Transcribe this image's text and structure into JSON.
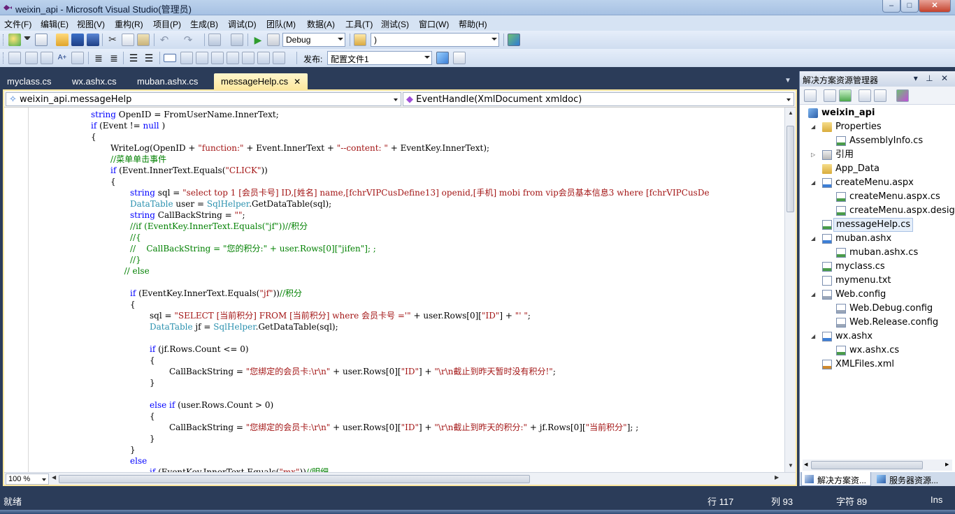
{
  "window": {
    "title": "weixin_api - Microsoft Visual Studio(管理员)",
    "minimize": "–",
    "maximize": "□",
    "close": "✕"
  },
  "menu": [
    "文件(F)",
    "编辑(E)",
    "视图(V)",
    "重构(R)",
    "项目(P)",
    "生成(B)",
    "调试(D)",
    "团队(M)",
    "数据(A)",
    "工具(T)",
    "测试(S)",
    "窗口(W)",
    "帮助(H)"
  ],
  "toolbar": {
    "config_value": "Debug",
    "find_value": ")",
    "publish_label": "发布:",
    "publish_value": "配置文件1"
  },
  "doc_tabs": [
    {
      "label": "myclass.cs",
      "active": false
    },
    {
      "label": "wx.ashx.cs",
      "active": false
    },
    {
      "label": "muban.ashx.cs",
      "active": false
    },
    {
      "label": "messageHelp.cs",
      "active": true
    }
  ],
  "doc_tab_close": "✕",
  "nav": {
    "type_combo": "weixin_api.messageHelp",
    "member_combo": "EventHandle(XmlDocument xmldoc)"
  },
  "zoom": "100 %",
  "code_lines": [
    {
      "indent": 4,
      "tokens": [
        [
          "kw",
          "string"
        ],
        [
          "",
          "OpenID = FromUserName.InnerText;"
        ]
      ]
    },
    {
      "indent": 4,
      "tokens": [
        [
          "kw",
          "if"
        ],
        [
          "",
          " (Event != "
        ],
        [
          "kw",
          "null"
        ],
        [
          "",
          ")"
        ]
      ]
    },
    {
      "indent": 4,
      "tokens": [
        [
          "",
          "{"
        ]
      ]
    },
    {
      "indent": 5,
      "tokens": [
        [
          "",
          "WriteLog(OpenID + "
        ],
        [
          "st",
          "\"function:\""
        ],
        [
          "",
          " + Event.InnerText + "
        ],
        [
          "st",
          "\"--content: \""
        ],
        [
          "",
          " + EventKey.InnerText);"
        ]
      ]
    },
    {
      "indent": 5,
      "tokens": [
        [
          "cm",
          "//菜单单击事件"
        ]
      ]
    },
    {
      "indent": 5,
      "tokens": [
        [
          "kw",
          "if"
        ],
        [
          "",
          " (Event.InnerText.Equals("
        ],
        [
          "st",
          "\"CLICK\""
        ],
        [
          "",
          "))"
        ]
      ]
    },
    {
      "indent": 5,
      "tokens": [
        [
          "",
          "{"
        ]
      ]
    },
    {
      "indent": 6,
      "tokens": [
        [
          "kw",
          "string"
        ],
        [
          "",
          " sql = "
        ],
        [
          "st",
          "\"select top 1 [会员卡号] ID,[姓名] name,[fchrVIPCusDefine13] openid,[手机] mobi from vip会员基本信息3 where [fchrVIPCusDe"
        ]
      ]
    },
    {
      "indent": 6,
      "tokens": [
        [
          "ty",
          "DataTable"
        ],
        [
          "",
          " user = "
        ],
        [
          "ty",
          "SqlHelper"
        ],
        [
          "",
          ".GetDataTable(sql);"
        ]
      ]
    },
    {
      "indent": 6,
      "tokens": [
        [
          "kw",
          "string"
        ],
        [
          "",
          " CallBackString = "
        ],
        [
          "st",
          "\"\""
        ],
        [
          "",
          ";"
        ]
      ]
    },
    {
      "indent": 6,
      "tokens": [
        [
          "cm",
          "//if (EventKey.InnerText.Equals(\"jf\"))//积分"
        ]
      ]
    },
    {
      "indent": 6,
      "tokens": [
        [
          "cm",
          "//{"
        ]
      ]
    },
    {
      "indent": 6,
      "tokens": [
        [
          "cm",
          "//    CallBackString = \"您的积分:\" + user.Rows[0][\"jifen\"]; ;"
        ]
      ]
    },
    {
      "indent": 6,
      "tokens": [
        [
          "cm",
          "//}"
        ]
      ]
    },
    {
      "indent": 5.7,
      "tokens": [
        [
          "cm",
          "// else"
        ]
      ]
    },
    {
      "indent": 6,
      "tokens": []
    },
    {
      "indent": 6,
      "tokens": [
        [
          "kw",
          "if"
        ],
        [
          "",
          " (EventKey.InnerText.Equals("
        ],
        [
          "st",
          "\"jf\""
        ],
        [
          "",
          "))"
        ],
        [
          "cm",
          "//积分"
        ]
      ]
    },
    {
      "indent": 6,
      "tokens": [
        [
          "",
          "{"
        ]
      ]
    },
    {
      "indent": 7,
      "tokens": [
        [
          "",
          "sql = "
        ],
        [
          "st",
          "\"SELECT [当前积分] FROM [当前积分] where 会员卡号 ='\""
        ],
        [
          "",
          " + user.Rows[0]["
        ],
        [
          "st",
          "\"ID\""
        ],
        [
          "",
          "] + "
        ],
        [
          "st",
          "\"' \""
        ],
        [
          "",
          ";"
        ]
      ]
    },
    {
      "indent": 7,
      "tokens": [
        [
          "ty",
          "DataTable"
        ],
        [
          "",
          " jf = "
        ],
        [
          "ty",
          "SqlHelper"
        ],
        [
          "",
          ".GetDataTable(sql);"
        ]
      ]
    },
    {
      "indent": 7,
      "tokens": []
    },
    {
      "indent": 7,
      "tokens": [
        [
          "kw",
          "if"
        ],
        [
          "",
          " (jf.Rows.Count <= 0)"
        ]
      ]
    },
    {
      "indent": 7,
      "tokens": [
        [
          "",
          "{"
        ]
      ]
    },
    {
      "indent": 8,
      "tokens": [
        [
          "",
          "CallBackString = "
        ],
        [
          "st",
          "\"您绑定的会员卡:\\r\\n\""
        ],
        [
          "",
          " + user.Rows[0]["
        ],
        [
          "st",
          "\"ID\""
        ],
        [
          "",
          "] + "
        ],
        [
          "st",
          "\"\\r\\n截止到昨天暂时没有积分!\""
        ],
        [
          "",
          ";"
        ]
      ]
    },
    {
      "indent": 7,
      "tokens": [
        [
          "",
          "}"
        ]
      ]
    },
    {
      "indent": 7,
      "tokens": []
    },
    {
      "indent": 7,
      "tokens": [
        [
          "kw",
          "else if"
        ],
        [
          "",
          " (user.Rows.Count > 0)"
        ]
      ]
    },
    {
      "indent": 7,
      "tokens": [
        [
          "",
          "{"
        ]
      ]
    },
    {
      "indent": 8,
      "tokens": [
        [
          "",
          "CallBackString = "
        ],
        [
          "st",
          "\"您绑定的会员卡:\\r\\n\""
        ],
        [
          "",
          " + user.Rows[0]["
        ],
        [
          "st",
          "\"ID\""
        ],
        [
          "",
          "] + "
        ],
        [
          "st",
          "\"\\r\\n截止到昨天的积分:\""
        ],
        [
          "",
          " + jf.Rows[0]["
        ],
        [
          "st",
          "\"当前积分\""
        ],
        [
          "",
          "]; ;"
        ]
      ]
    },
    {
      "indent": 7,
      "tokens": [
        [
          "",
          "}"
        ]
      ]
    },
    {
      "indent": 6,
      "tokens": [
        [
          "",
          "}"
        ]
      ]
    },
    {
      "indent": 6,
      "tokens": [
        [
          "kw",
          "else"
        ]
      ]
    },
    {
      "indent": 7,
      "tokens": [
        [
          "kw",
          "if"
        ],
        [
          "",
          " (EventKey.InnerText.Equals("
        ],
        [
          "st",
          "\"mx\""
        ],
        [
          "",
          "))"
        ],
        [
          "cm",
          "//明细"
        ]
      ]
    }
  ],
  "solution_explorer": {
    "title": "解决方案资源管理器",
    "header_icons": "▾ ⊥ ✕",
    "items": [
      {
        "label": "weixin_api",
        "level": 0,
        "expander": "",
        "icon": "project-icon",
        "bold": true
      },
      {
        "label": "Properties",
        "level": 1,
        "expander": "◢",
        "icon": "folder-icon"
      },
      {
        "label": "AssemblyInfo.cs",
        "level": 2,
        "expander": "",
        "icon": "cs-file-icon"
      },
      {
        "label": "引用",
        "level": 1,
        "expander": "▷",
        "icon": "references-icon"
      },
      {
        "label": "App_Data",
        "level": 1,
        "expander": "",
        "icon": "folder-icon"
      },
      {
        "label": "createMenu.aspx",
        "level": 1,
        "expander": "◢",
        "icon": "aspx-file-icon"
      },
      {
        "label": "createMenu.aspx.cs",
        "level": 2,
        "expander": "",
        "icon": "cs-file-icon"
      },
      {
        "label": "createMenu.aspx.designer.cs",
        "level": 2,
        "expander": "",
        "icon": "cs-file-icon"
      },
      {
        "label": "messageHelp.cs",
        "level": 1,
        "expander": "",
        "icon": "cs-file-icon",
        "selected": true
      },
      {
        "label": "muban.ashx",
        "level": 1,
        "expander": "◢",
        "icon": "ashx-file-icon"
      },
      {
        "label": "muban.ashx.cs",
        "level": 2,
        "expander": "",
        "icon": "cs-file-icon"
      },
      {
        "label": "myclass.cs",
        "level": 1,
        "expander": "",
        "icon": "cs-file-icon"
      },
      {
        "label": "mymenu.txt",
        "level": 1,
        "expander": "",
        "icon": "txt-file-icon"
      },
      {
        "label": "Web.config",
        "level": 1,
        "expander": "◢",
        "icon": "config-file-icon"
      },
      {
        "label": "Web.Debug.config",
        "level": 2,
        "expander": "",
        "icon": "config-file-icon"
      },
      {
        "label": "Web.Release.config",
        "level": 2,
        "expander": "",
        "icon": "config-file-icon"
      },
      {
        "label": "wx.ashx",
        "level": 1,
        "expander": "◢",
        "icon": "ashx-file-icon"
      },
      {
        "label": "wx.ashx.cs",
        "level": 2,
        "expander": "",
        "icon": "cs-file-icon"
      },
      {
        "label": "XMLFiles.xml",
        "level": 1,
        "expander": "",
        "icon": "xml-file-icon"
      }
    ],
    "bottom_tabs": [
      {
        "label": "解决方案资...",
        "active": true
      },
      {
        "label": "服务器资源...",
        "active": false
      }
    ]
  },
  "status": {
    "ready": "就绪",
    "line": "行 117",
    "col": "列 93",
    "char": "字符 89",
    "mode": "Ins"
  },
  "colors": {
    "frame": "#2b3c59",
    "active_tab": "#fde8a0",
    "keyword": "#0000ff",
    "type": "#2b91af",
    "string": "#a31515",
    "comment": "#008000"
  }
}
